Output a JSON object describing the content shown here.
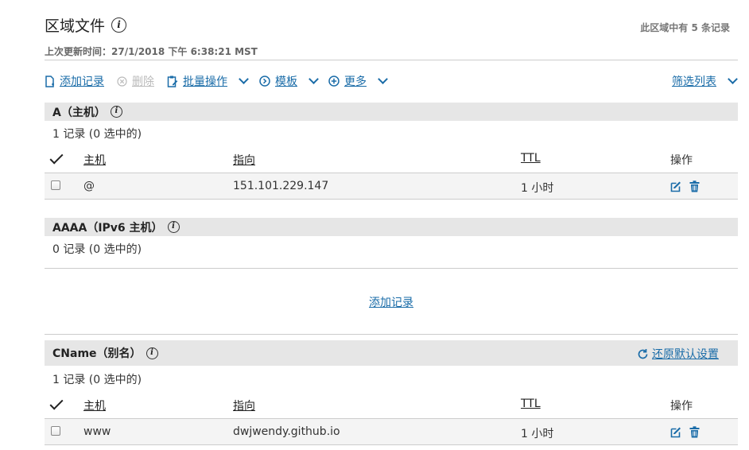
{
  "header": {
    "title": "区域文件",
    "record_count": "此区域中有 5 条记录",
    "updated": "上次更新时间：27/1/2018 下午 6:38:21 MST"
  },
  "toolbar": {
    "add": "添加记录",
    "delete": "删除",
    "bulk": "批量操作",
    "template": "模板",
    "more": "更多",
    "filter": "筛选列表"
  },
  "columns": {
    "host": "主机",
    "points_to": "指向",
    "ttl": "TTL",
    "actions": "操作"
  },
  "sections": [
    {
      "title": "A（主机）",
      "summary": "1 记录 (0 选中的)",
      "rows": [
        {
          "host": "@",
          "points_to": "151.101.229.147",
          "ttl": "1 小时"
        }
      ]
    },
    {
      "title": "AAAA（IPv6 主机）",
      "summary": "0 记录 (0 选中的)",
      "add_link": "添加记录"
    },
    {
      "title": "CName（别名）",
      "summary": "1 记录 (0 选中的)",
      "reset": "还原默认设置",
      "rows": [
        {
          "host": "www",
          "points_to": "dwjwendy.github.io",
          "ttl": "1 小时"
        }
      ]
    }
  ],
  "icons": {
    "info": "info-icon",
    "add": "add-file-icon",
    "delete": "circle-x-icon",
    "bulk": "clipboard-edit-icon",
    "template": "circle-chevron-icon",
    "more": "plus-circle-icon",
    "edit": "edit-icon",
    "trash": "trash-icon",
    "reset": "refresh-icon"
  },
  "colors": {
    "accent": "#1a6ca8",
    "section_bg": "#e6e6e6",
    "row_bg": "#f4f4f4"
  }
}
